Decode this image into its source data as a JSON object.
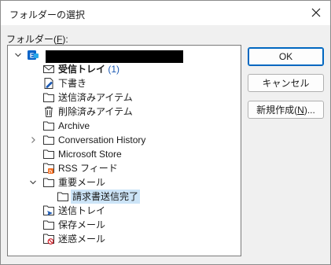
{
  "dialog": {
    "title": "フォルダーの選択",
    "folder_label_prefix": "フォルダー(",
    "folder_label_key": "F",
    "folder_label_suffix": "):"
  },
  "buttons": {
    "ok": "OK",
    "cancel": "キャンセル",
    "new_folder_prefix": "新規作成(",
    "new_folder_key": "N",
    "new_folder_suffix": ")..."
  },
  "tree": {
    "inbox": "受信トレイ",
    "inbox_count": "(1)",
    "drafts": "下書き",
    "sent_items": "送信済みアイテム",
    "deleted_items": "削除済みアイテム",
    "archive": "Archive",
    "conversation_history": "Conversation History",
    "microsoft_store": "Microsoft Store",
    "rss_feeds": "RSS フィード",
    "important_mail": "重要メール",
    "invoice_sent": "請求書送信完了",
    "outbox": "送信トレイ",
    "saved_mail": "保存メール",
    "junk_mail": "迷惑メール"
  },
  "colors": {
    "accent": "#0067c0",
    "selection": "#cce4f7",
    "count": "#1c5ab4",
    "outlook": "#0a64c8",
    "rss": "#f26d21",
    "junk": "#d0202a"
  }
}
